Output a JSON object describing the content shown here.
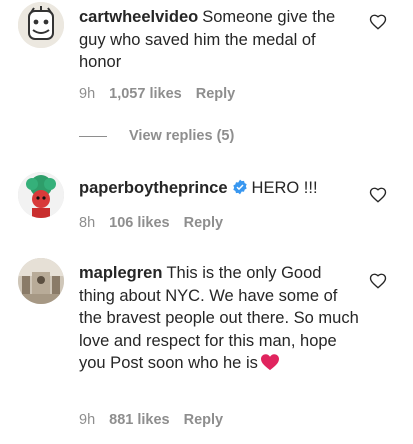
{
  "comments": [
    {
      "username": "cartwheelvideo",
      "text": "Someone give the guy who saved him the medal of honor",
      "time": "9h",
      "likes": "1,057 likes",
      "reply": "Reply",
      "view_replies": "View replies (5)"
    },
    {
      "username": "paperboytheprince",
      "text": "HERO !!!",
      "time": "8h",
      "likes": "106 likes",
      "reply": "Reply"
    },
    {
      "username": "maplegren",
      "text": "This is the only Good thing about NYC. We have some of the bravest people out there. So much love and respect for this man, hope you Post soon who he is",
      "time": "9h",
      "likes": "881 likes",
      "reply": "Reply"
    }
  ],
  "icons": {
    "like": "heart-outline-icon",
    "verified": "verified-badge-icon",
    "emoji": "red-heart-emoji"
  },
  "colors": {
    "text": "#262626",
    "muted": "#8e8e8e",
    "verified": "#3897f0",
    "emoji_heart": "#e0245e"
  }
}
